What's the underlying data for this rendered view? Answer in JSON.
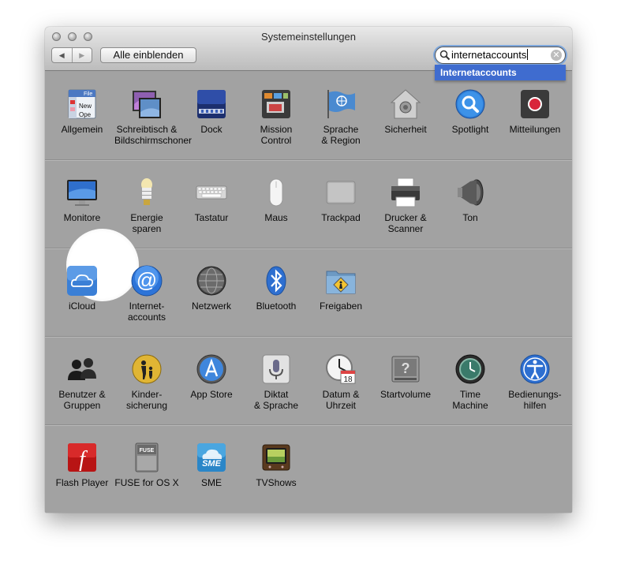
{
  "window": {
    "title": "Systemeinstellungen"
  },
  "toolbar": {
    "back": "◀",
    "forward": "▶",
    "show_all": "Alle einblenden"
  },
  "search": {
    "value": "internetaccounts",
    "clear": "✕",
    "suggestion": "Internetaccounts"
  },
  "rows": [
    [
      {
        "label1": "Allgemein",
        "label2": "",
        "icon": "general-icon"
      },
      {
        "label1": "Schreibtisch &",
        "label2": "Bildschirmschoner",
        "icon": "desktop-screensaver-icon"
      },
      {
        "label1": "Dock",
        "label2": "",
        "icon": "dock-icon"
      },
      {
        "label1": "Mission",
        "label2": "Control",
        "icon": "mission-control-icon"
      },
      {
        "label1": "Sprache",
        "label2": "& Region",
        "icon": "language-region-icon"
      },
      {
        "label1": "Sicherheit",
        "label2": "",
        "icon": "security-icon"
      },
      {
        "label1": "Spotlight",
        "label2": "",
        "icon": "spotlight-icon"
      },
      {
        "label1": "Mitteilungen",
        "label2": "",
        "icon": "notifications-icon"
      }
    ],
    [
      {
        "label1": "Monitore",
        "label2": "",
        "icon": "displays-icon"
      },
      {
        "label1": "Energie",
        "label2": "sparen",
        "icon": "energy-saver-icon"
      },
      {
        "label1": "Tastatur",
        "label2": "",
        "icon": "keyboard-icon"
      },
      {
        "label1": "Maus",
        "label2": "",
        "icon": "mouse-icon"
      },
      {
        "label1": "Trackpad",
        "label2": "",
        "icon": "trackpad-icon"
      },
      {
        "label1": "Drucker &",
        "label2": "Scanner",
        "icon": "printer-icon"
      },
      {
        "label1": "Ton",
        "label2": "",
        "icon": "sound-icon"
      }
    ],
    [
      {
        "label1": "iCloud",
        "label2": "",
        "icon": "icloud-icon"
      },
      {
        "label1": "Internet-",
        "label2": "accounts",
        "icon": "internet-accounts-icon"
      },
      {
        "label1": "Netzwerk",
        "label2": "",
        "icon": "network-icon"
      },
      {
        "label1": "Bluetooth",
        "label2": "",
        "icon": "bluetooth-icon"
      },
      {
        "label1": "Freigaben",
        "label2": "",
        "icon": "sharing-icon"
      }
    ],
    [
      {
        "label1": "Benutzer &",
        "label2": "Gruppen",
        "icon": "users-groups-icon"
      },
      {
        "label1": "Kinder-",
        "label2": "sicherung",
        "icon": "parental-controls-icon"
      },
      {
        "label1": "App Store",
        "label2": "",
        "icon": "app-store-icon"
      },
      {
        "label1": "Diktat",
        "label2": "& Sprache",
        "icon": "dictation-icon"
      },
      {
        "label1": "Datum &",
        "label2": "Uhrzeit",
        "icon": "date-time-icon"
      },
      {
        "label1": "Startvolume",
        "label2": "",
        "icon": "startup-disk-icon"
      },
      {
        "label1": "Time",
        "label2": "Machine",
        "icon": "time-machine-icon"
      },
      {
        "label1": "Bedienungs-",
        "label2": "hilfen",
        "icon": "accessibility-icon"
      }
    ],
    [
      {
        "label1": "Flash Player",
        "label2": "",
        "icon": "flash-player-icon"
      },
      {
        "label1": "FUSE for OS X",
        "label2": "",
        "icon": "fuse-icon"
      },
      {
        "label1": "SME",
        "label2": "",
        "icon": "sme-icon"
      },
      {
        "label1": "TVShows",
        "label2": "",
        "icon": "tvshows-icon"
      }
    ]
  ],
  "icon_text": {
    "file": "File",
    "new": "New",
    "open": "Ope",
    "calendar_day": "18",
    "fuse": "FUSE",
    "sme": "SME",
    "flash": "f",
    "at": "@"
  }
}
